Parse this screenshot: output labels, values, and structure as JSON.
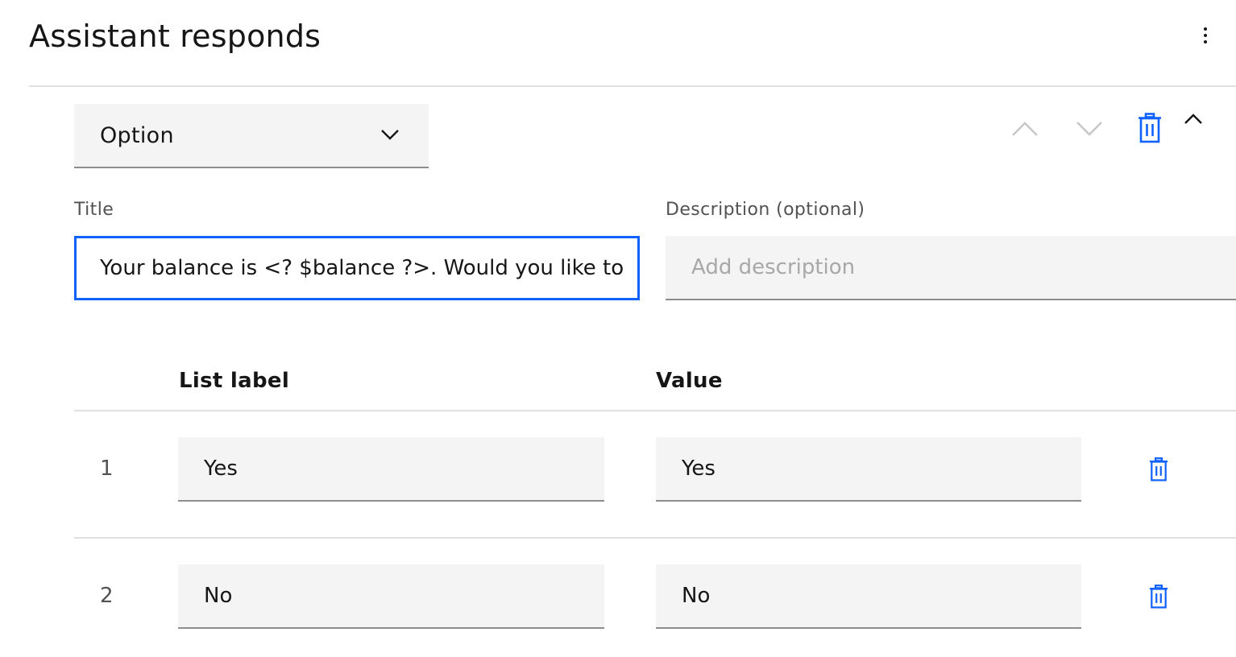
{
  "header": {
    "title": "Assistant responds",
    "overflow_icon": "overflow-menu-vertical-icon"
  },
  "response_type": {
    "selected": "Option",
    "icon": "chevron-down-icon"
  },
  "toolbar": {
    "move_up_icon": "chevron-up-icon",
    "move_down_icon": "chevron-down-icon",
    "delete_icon": "trash-can-icon",
    "collapse_icon": "chevron-up-icon",
    "accent_color": "#0f62fe"
  },
  "title_field": {
    "label": "Title",
    "value": "Your balance is <? $balance ?>. Would you like to"
  },
  "description_field": {
    "label": "Description (optional)",
    "value": "",
    "placeholder": "Add description"
  },
  "options_table": {
    "headers": {
      "list_label": "List label",
      "value": "Value"
    },
    "rows": [
      {
        "number": "1",
        "label": "Yes",
        "value": "Yes"
      },
      {
        "number": "2",
        "label": "No",
        "value": "No"
      }
    ]
  }
}
